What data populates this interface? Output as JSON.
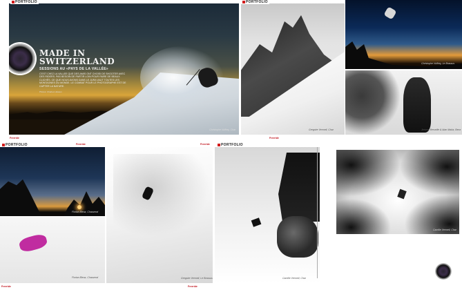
{
  "spread1": {
    "section_tag": "PORTFOLIO",
    "title_line1": "MADE IN",
    "title_line2": "SWITZERLAND",
    "subtitle": "SESSIONS AU «PAYS DE LA VALLÉE»",
    "body": "C'EST CHEZ LA VALLEE QUE DES AMIS ONT CHOISI DE SHOOTER AVEC DES RIDERS. PAS BESOIN DE PARTIR LOIN POUR FAIRE DE BEAUX CLICHÉS. CE QUE NOUS AVONS DANS LE JURA VAUT TOUTES LES MONTAGNES DU MONDE. LE COMBAT POUR LE PHOTOGRAPHE EST DE CAPTER LA NATURE.",
    "byline": "Photos: Charles Lidasen",
    "credit_main": "Christophe Vuffrey, Char",
    "credit_mountain": "Gregoire Vermeil, Char",
    "credit_night": "Christophe Vuffrey, Le Brassus",
    "credit_skier": "Jerome Berseille & Alan Makiz, Benz"
  },
  "spread2": {
    "section_tag": "PORTFOLIO",
    "credit_sunset": "Florian Bleuz, Chasseral",
    "credit_pink": "Florian Bleuz, Chasseral",
    "credit_powder": "Gregoire Vermeil, Le Brassus",
    "credit_cliff": "Camille Vermeil, Char",
    "credit_trees": "Camille Vermeil, Char"
  },
  "folios": {
    "top_left": "Freeride",
    "top_right": "Freeride",
    "mid_left": "Freeride",
    "mid_right": "Freeride",
    "bottom_left": "Freeride",
    "bottom_mid": "Freeride"
  },
  "icons": [
    "camera-lens-icon",
    "camera-lens-icon-small"
  ]
}
